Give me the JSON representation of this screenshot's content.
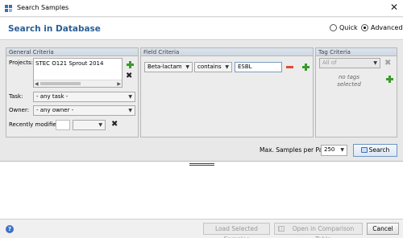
{
  "window": {
    "title": "Search Samples",
    "close_glyph": "✕"
  },
  "header": {
    "title": "Search in Database",
    "modes": [
      {
        "label": "Quick",
        "selected": false
      },
      {
        "label": "Advanced",
        "selected": true
      }
    ]
  },
  "general": {
    "title": "General Criteria",
    "projects_label": "Projects:",
    "projects": [
      "STEC O121 Sprout 2014"
    ],
    "task_label": "Task:",
    "task_value": "- any task -",
    "owner_label": "Owner:",
    "owner_value": "- any owner -",
    "recently_label": "Recently modified:"
  },
  "field": {
    "title": "Field Criteria",
    "field_value": "Beta-lactam",
    "operator_value": "contains",
    "search_text": "ESBL"
  },
  "tag": {
    "title": "Tag Criteria",
    "scope_value": "All of",
    "empty_line1": "no tags",
    "empty_line2": "selected"
  },
  "search_bar": {
    "max_label": "Max. Samples per Page:",
    "max_value": "250",
    "search_button": "Search"
  },
  "footer": {
    "help_glyph": "?",
    "load_button": "Load Selected Samples",
    "open_button": "Open in Comparison Table",
    "cancel_button": "Cancel"
  },
  "colors": {
    "title_blue": "#2d5f95",
    "add_green": "#3c9a2c",
    "remove_red": "#e04a2e"
  }
}
